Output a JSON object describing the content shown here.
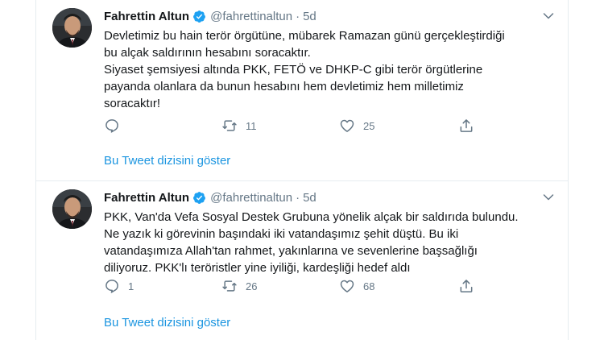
{
  "tweets": [
    {
      "author_name": "Fahrettin Altun",
      "handle": "@fahrettinaltun",
      "separator": "·",
      "time": "5d",
      "lines": [
        "Devletimiz bu hain terör örgütüne, mübarek Ramazan günü gerçekleştirdiği",
        "bu alçak saldırının hesabını soracaktır.",
        "Siyaset şemsiyesi altında PKK, FETÖ ve DHKP-C gibi terör örgütlerine",
        "payanda olanlara da bunun hesabını hem devletimiz hem milletimiz",
        "soracaktır!"
      ],
      "reply_count": "",
      "retweet_count": "11",
      "like_count": "25",
      "show_thread_label": "Bu Tweet dizisini göster"
    },
    {
      "author_name": "Fahrettin Altun",
      "handle": "@fahrettinaltun",
      "separator": "·",
      "time": "5d",
      "lines": [
        "PKK, Van'da Vefa Sosyal Destek Grubuna yönelik alçak bir saldırıda bulundu.",
        "Ne yazık ki görevinin başındaki iki vatandaşımız şehit düştü. Bu iki",
        "vatandaşımıza Allah'tan rahmet, yakınlarına ve sevenlerine başsağlığı",
        "diliyoruz. PKK'lı teröristler yine iyiliği, kardeşliği hedef aldı"
      ],
      "reply_count": "1",
      "retweet_count": "26",
      "like_count": "68",
      "show_thread_label": "Bu Tweet dizisini göster"
    }
  ],
  "icons": {
    "verified": "verified-badge-icon",
    "caret": "chevron-down-icon",
    "reply": "reply-icon",
    "retweet": "retweet-icon",
    "like": "heart-icon",
    "share": "share-icon"
  },
  "colors": {
    "text": "#14171a",
    "secondary": "#657786",
    "link": "#1b95e0",
    "verified": "#1da1f2",
    "border": "#e6ecf0"
  }
}
